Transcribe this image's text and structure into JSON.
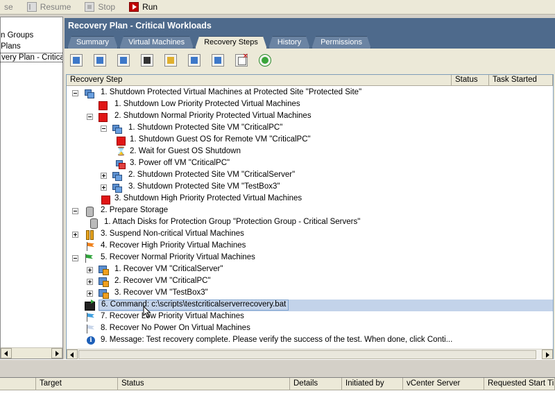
{
  "toolbar": {
    "pause_label": "se",
    "resume_label": "Resume",
    "stop_label": "Stop",
    "run_label": "Run"
  },
  "left_tree": {
    "items": [
      {
        "label": "n Groups"
      },
      {
        "label": " Plans"
      },
      {
        "label": "very Plan - Critical W"
      }
    ]
  },
  "panel": {
    "title": "Recovery Plan - Critical Workloads",
    "tabs": [
      {
        "label": "Summary"
      },
      {
        "label": "Virtual Machines"
      },
      {
        "label": "Recovery Steps"
      },
      {
        "label": "History"
      },
      {
        "label": "Permissions"
      }
    ],
    "active_tab": "Recovery Steps"
  },
  "toolbar_icons": [
    "add-step-before-icon",
    "add-step-after-icon",
    "add-prompt-icon",
    "add-command-icon",
    "edit-step-icon",
    "move-up-icon",
    "move-down-icon",
    "delete-step-icon",
    "refresh-icon"
  ],
  "grid": {
    "columns": [
      "Recovery Step",
      "Status",
      "Task Started"
    ],
    "rows": [
      {
        "text": "1. Shutdown Protected Virtual Machines at Protected Site \"Protected Site\"",
        "icon": "vm"
      },
      {
        "text": "1. Shutdown Low Priority Protected Virtual Machines",
        "icon": "red"
      },
      {
        "text": "2. Shutdown Normal Priority Protected Virtual Machines",
        "icon": "red"
      },
      {
        "text": "1. Shutdown Protected Site VM \"CriticalPC\"",
        "icon": "vm"
      },
      {
        "text": "1. Shutdown Guest OS for Remote VM \"CriticalPC\"",
        "icon": "red"
      },
      {
        "text": "2. Wait for Guest OS Shutdown",
        "icon": "hourglass"
      },
      {
        "text": "3. Power off VM \"CriticalPC\"",
        "icon": "vm-red"
      },
      {
        "text": "2. Shutdown Protected Site VM \"CriticalServer\"",
        "icon": "vm"
      },
      {
        "text": "3. Shutdown Protected Site VM \"TestBox3\"",
        "icon": "vm"
      },
      {
        "text": "3. Shutdown High Priority Protected Virtual Machines",
        "icon": "red"
      },
      {
        "text": "2. Prepare Storage",
        "icon": "storage"
      },
      {
        "text": "1. Attach Disks for Protection Group \"Protection Group - Critical Servers\"",
        "icon": "storage"
      },
      {
        "text": "3. Suspend Non-critical Virtual Machines",
        "icon": "pause"
      },
      {
        "text": "4. Recover High Priority Virtual Machines",
        "icon": "flag-orange"
      },
      {
        "text": "5. Recover Normal Priority Virtual Machines",
        "icon": "flag-green"
      },
      {
        "text": "1. Recover VM \"CriticalServer\"",
        "icon": "vmrec"
      },
      {
        "text": "2. Recover VM \"CriticalPC\"",
        "icon": "vmrec"
      },
      {
        "text": "3. Recover VM \"TestBox3\"",
        "icon": "vmrec"
      },
      {
        "text": "6. Command: c:\\scripts\\testcriticalserverrecovery.bat",
        "icon": "cmd",
        "selected": true
      },
      {
        "text": "7. Recover Low Priority Virtual Machines",
        "icon": "flag-blue"
      },
      {
        "text": "8. Recover No Power On Virtual Machines",
        "icon": "flag-white"
      },
      {
        "text": "9. Message: Test recovery complete. Please verify the success of the test. When done, click Conti...",
        "icon": "info"
      }
    ]
  },
  "tasks": {
    "columns": [
      "Target",
      "Status",
      "Details",
      "Initiated by",
      "vCenter Server",
      "Requested Start Ti..."
    ]
  },
  "colors": {
    "header_bg": "#4e6a8c",
    "selection": "#c3d3ea",
    "window_bg": "#ece9d8"
  }
}
